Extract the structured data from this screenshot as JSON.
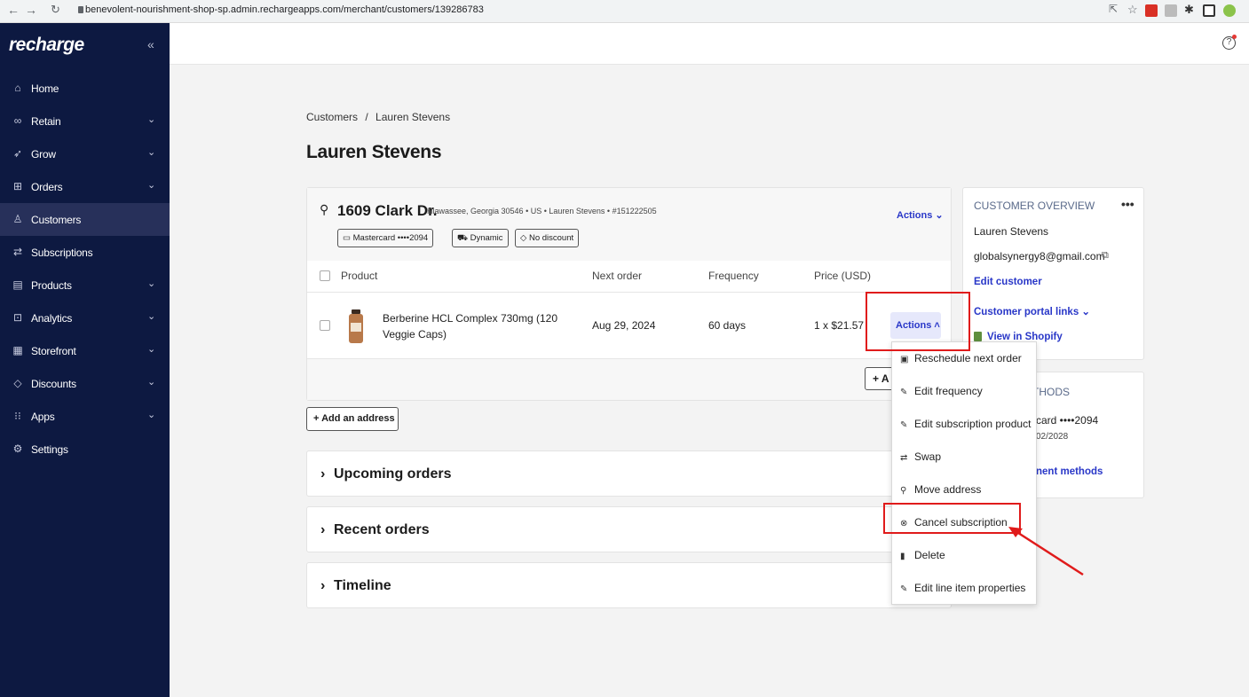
{
  "browser": {
    "url": "benevolent-nourishment-shop-sp.admin.rechargeapps.com/merchant/customers/139286783"
  },
  "sidebar": {
    "logo": "recharge",
    "collapse_icon": "double-chevron-left-icon",
    "items": [
      {
        "label": "Home",
        "icon": "home-icon",
        "has_chevron": false
      },
      {
        "label": "Retain",
        "icon": "infinity-icon",
        "has_chevron": true
      },
      {
        "label": "Grow",
        "icon": "rocket-icon",
        "has_chevron": true
      },
      {
        "label": "Orders",
        "icon": "cart-icon",
        "has_chevron": true
      },
      {
        "label": "Customers",
        "icon": "user-icon",
        "has_chevron": false,
        "active": true
      },
      {
        "label": "Subscriptions",
        "icon": "repeat-icon",
        "has_chevron": false
      },
      {
        "label": "Products",
        "icon": "box-icon",
        "has_chevron": true
      },
      {
        "label": "Analytics",
        "icon": "chart-icon",
        "has_chevron": true
      },
      {
        "label": "Storefront",
        "icon": "store-icon",
        "has_chevron": true
      },
      {
        "label": "Discounts",
        "icon": "tag-icon",
        "has_chevron": true
      },
      {
        "label": "Apps",
        "icon": "grid-icon",
        "has_chevron": true
      },
      {
        "label": "Settings",
        "icon": "gear-icon",
        "has_chevron": false
      }
    ]
  },
  "breadcrumb": {
    "parent": "Customers",
    "separator": "/",
    "current": "Lauren Stevens"
  },
  "page_title": "Lauren Stevens",
  "address_card": {
    "street": "1609 Clark Dr.",
    "details": "Hiawassee, Georgia 30546  •  US  •  Lauren Stevens  •  #151222505",
    "actions_label": "Actions",
    "pills": [
      "Mastercard ••••2094",
      "Dynamic",
      "No discount"
    ],
    "columns": [
      "Product",
      "Next order",
      "Frequency",
      "Price (USD)"
    ],
    "row": {
      "product": "Berberine HCL Complex 730mg (120 Veggie Caps)",
      "next_order": "Aug 29, 2024",
      "frequency": "60 days",
      "price": "1 x $21.57",
      "actions_label": "Actions"
    },
    "add_button_partial": "+ A"
  },
  "add_address_label": "+ Add an address",
  "sections": [
    "Upcoming orders",
    "Recent orders",
    "Timeline"
  ],
  "customer_overview": {
    "heading": "CUSTOMER OVERVIEW",
    "more_icon": "ellipsis-icon",
    "name": "Lauren Stevens",
    "email": "globalsynergy8@gmail.com",
    "edit_label": "Edit customer",
    "portal_label": "Customer portal links",
    "shopify_label": "View in Shopify"
  },
  "payment_card": {
    "heading_partial": "THODS",
    "card_partial": "card ••••2094",
    "expiry_partial": "02/2028",
    "link_partial": "nent methods"
  },
  "actions_menu": [
    {
      "label": "Reschedule next order",
      "icon": "calendar-icon"
    },
    {
      "label": "Edit frequency",
      "icon": "pencil-icon"
    },
    {
      "label": "Edit subscription product",
      "icon": "pencil-icon"
    },
    {
      "label": "Swap",
      "icon": "swap-icon"
    },
    {
      "label": "Move address",
      "icon": "pin-icon"
    },
    {
      "label": "Cancel subscription",
      "icon": "x-circle-icon"
    },
    {
      "label": "Delete",
      "icon": "trash-icon"
    },
    {
      "label": "Edit line item properties",
      "icon": "pencil-icon"
    }
  ],
  "colors": {
    "sidebar": "#0d1941",
    "link": "#2937c8",
    "highlight": "#e01b1b",
    "overview_heading": "#5a6a8a"
  }
}
